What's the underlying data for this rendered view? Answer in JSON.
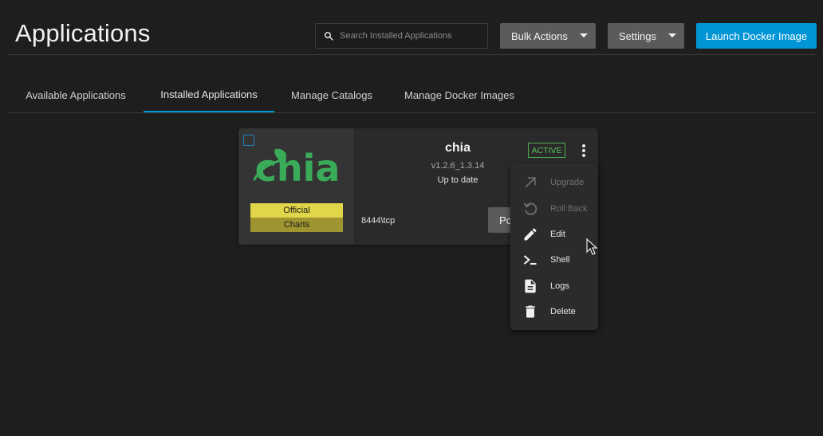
{
  "header": {
    "title": "Applications",
    "search_placeholder": "Search Installed Applications",
    "bulk_actions_label": "Bulk Actions",
    "settings_label": "Settings",
    "launch_label": "Launch Docker Image"
  },
  "tabs": [
    {
      "label": "Available Applications",
      "active": false
    },
    {
      "label": "Installed Applications",
      "active": true
    },
    {
      "label": "Manage Catalogs",
      "active": false
    },
    {
      "label": "Manage Docker Images",
      "active": false
    }
  ],
  "app_card": {
    "logo_text": "chia",
    "badge_official": "Official",
    "badge_charts": "Charts",
    "name": "chia",
    "version": "v1.2.6_1.3.14",
    "update_status": "Up to date",
    "status": "ACTIVE",
    "port": "8444\\tcp",
    "portal_label": "Portal"
  },
  "context_menu": {
    "items": [
      {
        "label": "Upgrade",
        "icon": "arrow-up-right-icon",
        "disabled": true
      },
      {
        "label": "Roll Back",
        "icon": "restore-icon",
        "disabled": true
      },
      {
        "label": "Edit",
        "icon": "pencil-icon",
        "disabled": false
      },
      {
        "label": "Shell",
        "icon": "console-icon",
        "disabled": false
      },
      {
        "label": "Logs",
        "icon": "file-document-icon",
        "disabled": false
      },
      {
        "label": "Delete",
        "icon": "trash-icon",
        "disabled": false
      }
    ]
  },
  "colors": {
    "accent": "#0095d5",
    "status_active": "#4caf50",
    "chia_green": "#3aac59",
    "badge_official": "#e1d54a",
    "badge_charts": "#9e9430"
  }
}
